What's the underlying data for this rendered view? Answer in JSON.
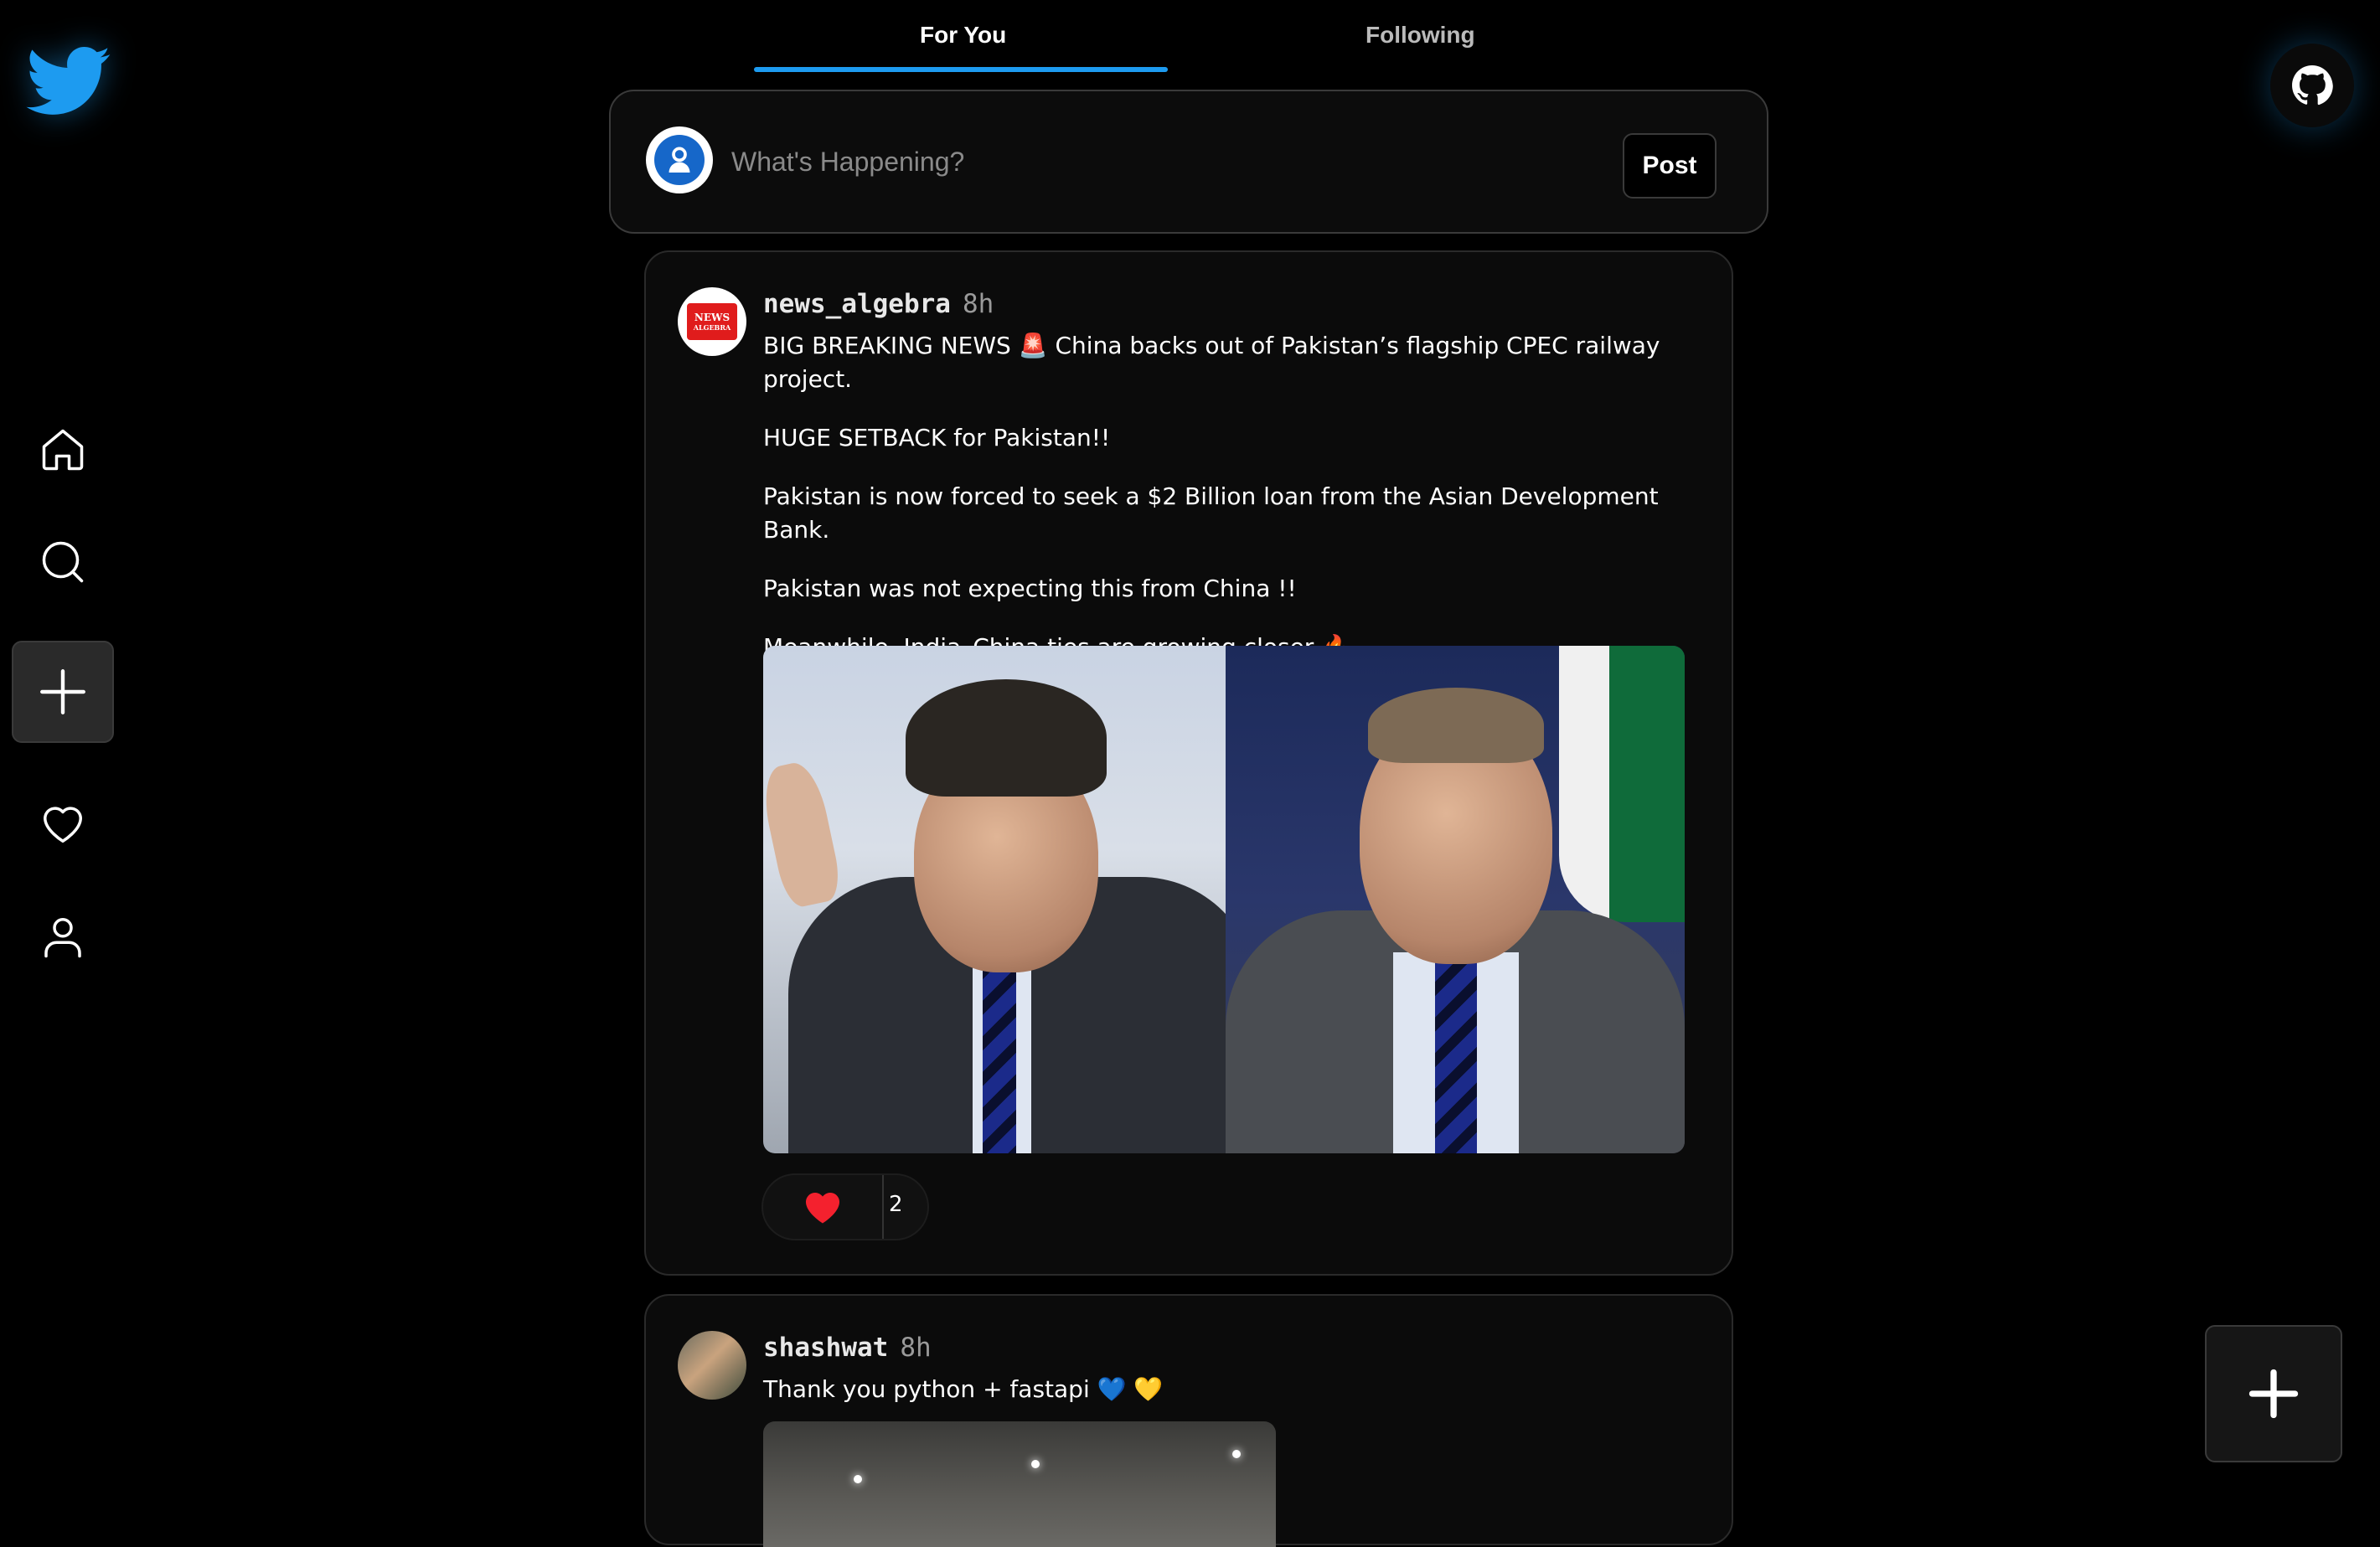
{
  "app": {
    "logo": "twitter-bird-icon",
    "accent": "#1d9bf0"
  },
  "tabs": [
    {
      "label": "For You",
      "active": true
    },
    {
      "label": "Following",
      "active": false
    }
  ],
  "composer": {
    "placeholder": "What's Happening?",
    "post_label": "Post"
  },
  "sidebar": [
    "home-icon",
    "search-icon",
    "plus-icon",
    "heart-icon",
    "user-icon"
  ],
  "posts": [
    {
      "username": "news_algebra",
      "time": "8h",
      "avatar_text": [
        "NEWS",
        "ALGEBRA"
      ],
      "lines": [
        "BIG BREAKING NEWS 🚨 China backs out of Pakistan’s flagship CPEC railway project.",
        "HUGE SETBACK for Pakistan!!",
        "Pakistan is now forced to seek a $2 Billion loan from the Asian Development Bank.",
        "Pakistan was not expecting this from China !!",
        "Meanwhile, India–China ties are growing closer 🔥"
      ],
      "likes": "2",
      "liked": true
    },
    {
      "username": "shashwat",
      "time": "8h",
      "lines": [
        "Thank you python + fastapi 💙 💛"
      ]
    }
  ]
}
